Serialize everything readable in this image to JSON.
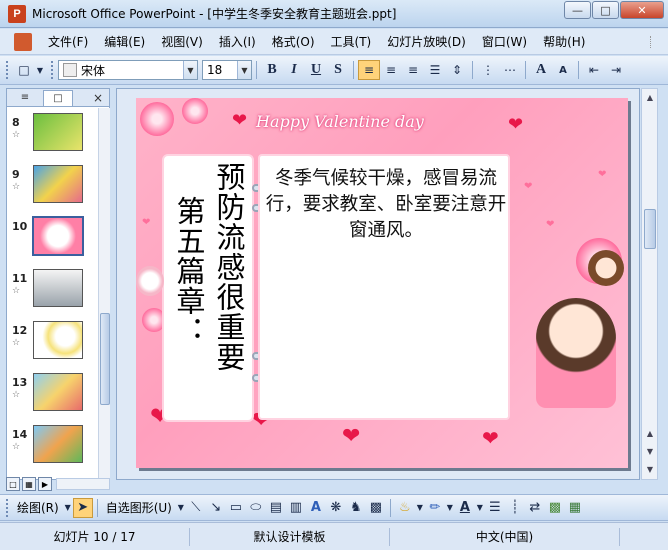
{
  "window": {
    "title": "Microsoft Office PowerPoint - [中学生冬季安全教育主题班会.ppt]",
    "app_icon": "powerpoint-icon",
    "controls": [
      "minimize",
      "maximize",
      "close"
    ]
  },
  "menu": {
    "items": [
      "文件(F)",
      "编辑(E)",
      "视图(V)",
      "插入(I)",
      "格式(O)",
      "工具(T)",
      "幻灯片放映(D)",
      "窗口(W)",
      "帮助(H)"
    ]
  },
  "format_toolbar": {
    "font_name": "宋体",
    "font_size": "18",
    "bold": "B",
    "italic": "I",
    "underline": "U",
    "shadow": "S",
    "grow": "A",
    "shrink": "A"
  },
  "outline_panel": {
    "tabs": [
      "outline-tab",
      "slides-tab"
    ],
    "close": "×",
    "thumbnails": [
      {
        "num": "8",
        "star": "☆"
      },
      {
        "num": "9",
        "star": "☆"
      },
      {
        "num": "10",
        "star": ""
      },
      {
        "num": "11",
        "star": "☆"
      },
      {
        "num": "12",
        "star": "☆"
      },
      {
        "num": "13",
        "star": "☆"
      },
      {
        "num": "14",
        "star": "☆"
      }
    ],
    "selected": "10"
  },
  "slide": {
    "banner": "Happy Valentine day",
    "heading_col1": "预防流感很重要",
    "heading_col2": "第五篇章：",
    "body": "冬季气候较干燥，感冒易流行，要求教室、卧室要注意开窗通风。",
    "accent": "#e8184a"
  },
  "draw_toolbar": {
    "draw": "绘图(R)",
    "autoshapes": "自选图形(U)"
  },
  "status": {
    "slide": "幻灯片 10 / 17",
    "design": "默认设计模板",
    "language": "中文(中国)"
  }
}
